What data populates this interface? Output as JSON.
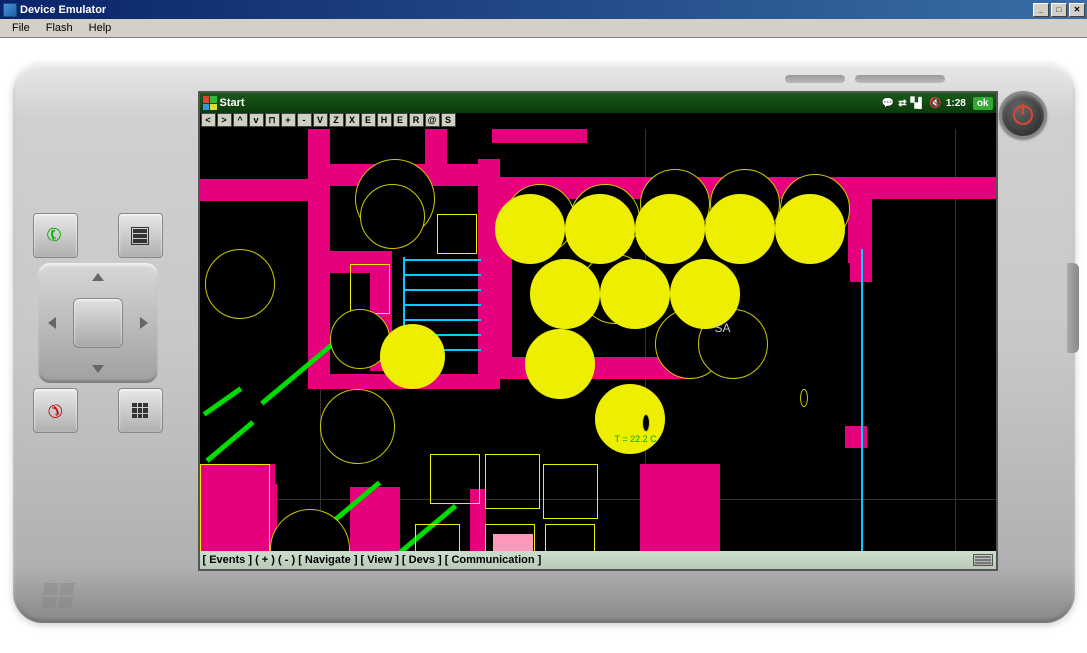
{
  "window": {
    "title": "Device Emulator",
    "menu": {
      "file": "File",
      "flash": "Flash",
      "help": "Help"
    }
  },
  "wm_topbar": {
    "start": "Start",
    "time": "1:28",
    "ok": "ok"
  },
  "toolbar_buttons": [
    "<",
    ">",
    "^",
    "v",
    "⊓",
    "+",
    "-",
    "V",
    "Z",
    "X",
    "E",
    "H",
    "E",
    "R",
    "@",
    "S"
  ],
  "canvas": {
    "label_sa": "SA",
    "temp_display": "T = 22.2 C"
  },
  "bottom_bar": {
    "events": "[ Events ]",
    "plus": "(   +   )",
    "minus": "(   -   )",
    "navigate": "[ Navigate ]",
    "view": "[ View ]",
    "devs": "[ Devs ]",
    "comm": "[ Communication ]"
  }
}
